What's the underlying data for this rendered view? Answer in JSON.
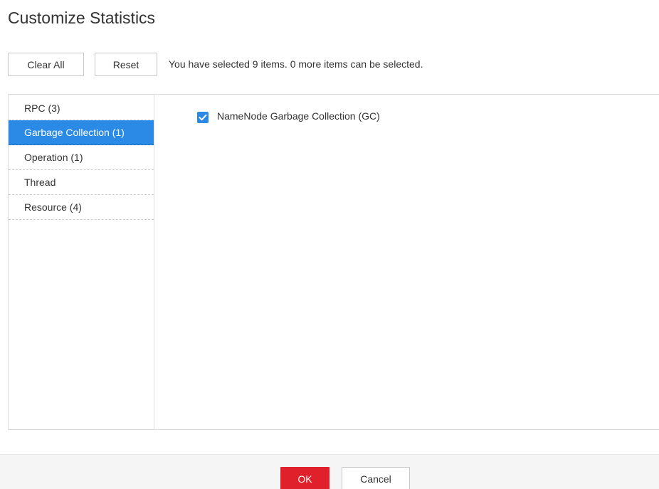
{
  "dialog": {
    "title": "Customize Statistics"
  },
  "toolbar": {
    "clear_all_label": "Clear All",
    "reset_label": "Reset",
    "selection_info": "You have selected 9 items. 0 more items can be selected."
  },
  "sidebar": {
    "items": [
      {
        "label": "RPC (3)",
        "active": false
      },
      {
        "label": "Garbage Collection (1)",
        "active": true
      },
      {
        "label": "Operation (1)",
        "active": false
      },
      {
        "label": "Thread",
        "active": false
      },
      {
        "label": "Resource (4)",
        "active": false
      }
    ]
  },
  "content": {
    "options": [
      {
        "label": "NameNode Garbage Collection (GC)",
        "checked": true
      }
    ]
  },
  "footer": {
    "ok_label": "OK",
    "cancel_label": "Cancel"
  },
  "colors": {
    "accent": "#2a8ae6",
    "ok_button": "#e0202a"
  },
  "icons": {
    "checkbox": "check-icon"
  }
}
